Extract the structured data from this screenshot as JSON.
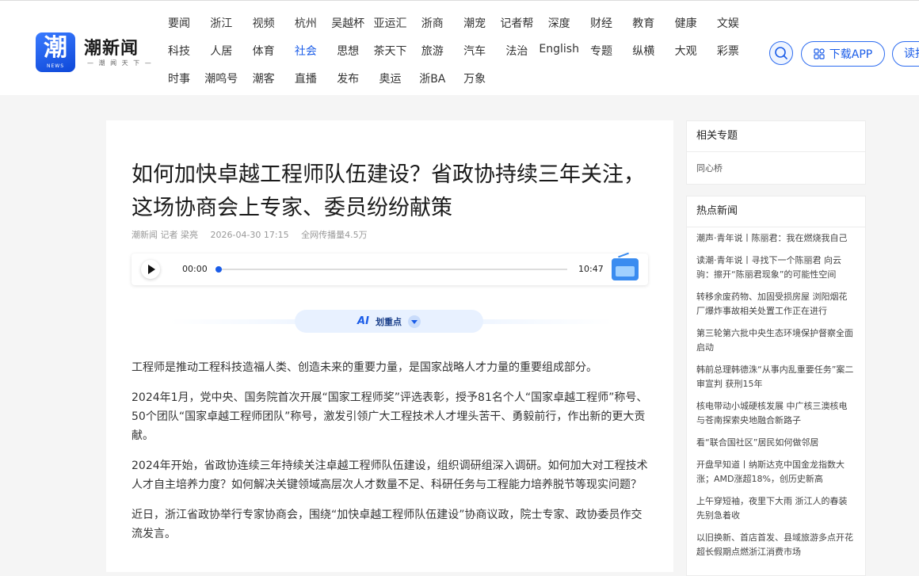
{
  "logo": {
    "icon_char": "潮",
    "icon_sub": "NEWS",
    "name": "潮新闻",
    "slogan": "— 潮 闻 天 下 —"
  },
  "nav": {
    "rows": [
      [
        "要闻",
        "浙江",
        "视频",
        "杭州",
        "吴越杯",
        "亚运汇",
        "浙商",
        "潮宠",
        "记者帮",
        "深度",
        "财经",
        "教育",
        "健康",
        "文娱"
      ],
      [
        "科技",
        "人居",
        "体育",
        "社会",
        "思想",
        "茶天下",
        "旅游",
        "汽车",
        "法治",
        "English",
        "专题",
        "纵横",
        "大观",
        "彩票"
      ],
      [
        "时事",
        "潮鸣号",
        "潮客",
        "直播",
        "发布",
        "奥运",
        "浙BA",
        "万象"
      ]
    ],
    "active": "社会",
    "active_color": "#1a5ce8"
  },
  "header_actions": {
    "search_icon": "search-icon",
    "download_label": "下载APP",
    "download_icon": "app-grid-icon",
    "read_label": "读报"
  },
  "article": {
    "title": "如何加快卓越工程师队伍建设？省政协持续三年关注，这场协商会上专家、委员纷纷献策",
    "source": "潮新闻 记者 梁亮",
    "datetime": "2026-04-30 17:15",
    "reach": "全网传播量4.5万",
    "audio": {
      "current": "00:00",
      "total": "10:47",
      "progress": 0,
      "play_icon": "play-icon",
      "radio_icon": "radio-icon"
    },
    "ai_highlight": {
      "logo": "AI",
      "label": "划重点"
    },
    "paragraphs": [
      "工程师是推动工程科技造福人类、创造未来的重要力量，是国家战略人才力量的重要组成部分。",
      "2024年1月，党中央、国务院首次开展“国家工程师奖”评选表彰，授予81名个人“国家卓越工程师”称号、50个团队“国家卓越工程师团队”称号，激发引领广大工程技术人才埋头苦干、勇毅前行，作出新的更大贡献。",
      "2024年开始，省政协连续三年持续关注卓越工程师队伍建设，组织调研组深入调研。如何加大对工程技术人才自主培养力度？如何解决关键领域高层次人才数量不足、科研任务与工程能力培养脱节等现实问题？",
      "近日，浙江省政协举行专家协商会，围绕“加快卓越工程师队伍建设”协商议政，院士专家、政协委员作交流发言。"
    ]
  },
  "sidebar": {
    "topics": {
      "heading": "相关专题",
      "items": [
        "同心桥"
      ]
    },
    "hot": {
      "heading": "热点新闻",
      "items": [
        "潮声·青年说丨陈丽君：我在燃烧我自己",
        "读潮·青年说丨寻找下一个陈丽君 向云驹：擦开“陈丽君现象”的可能性空间",
        "转移余废药物、加固受损房屋 浏阳烟花厂爆炸事故相关处置工作正在进行",
        "第三轮第六批中央生态环境保护督察全面启动",
        "韩前总理韩德洙“从事内乱重要任务”案二审宣判 获刑15年",
        "核电带动小城硬核发展 中广核三澳核电与苍南探索央地融合新路子",
        "看“联合国社区”居民如何做邻居",
        "开盘早知道丨纳斯达克中国金龙指数大涨；AMD涨超18%，创历史新高",
        "上午穿短袖，夜里下大雨 浙江人的春装先别急着收",
        "以旧换新、首店首发、县域旅游多点开花 超长假期点燃浙江消费市场"
      ]
    }
  },
  "colors": {
    "accent": "#1a5ce8",
    "page_bg": "#f5f5f5"
  }
}
